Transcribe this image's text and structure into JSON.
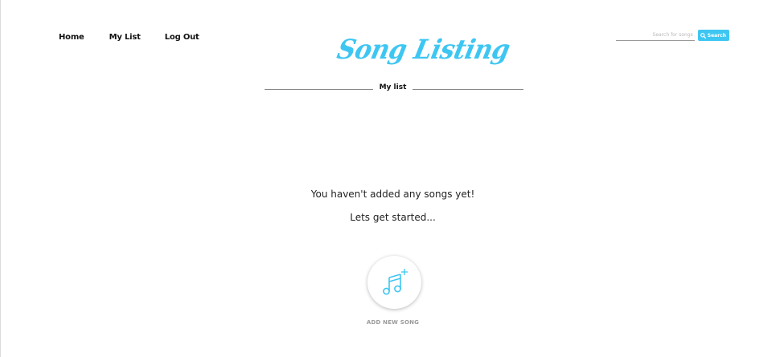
{
  "nav": {
    "home": "Home",
    "my_list": "My List",
    "log_out": "Log Out"
  },
  "logo": {
    "text": "Song Listing"
  },
  "section": {
    "title": "My list"
  },
  "search": {
    "placeholder": "Search for songs",
    "value": "",
    "button_label": "Search",
    "button_icon": "search-icon"
  },
  "empty_state": {
    "title": "You haven't added any songs yet!",
    "subtitle": "Lets get started..."
  },
  "add_song": {
    "label": "ADD NEW SONG",
    "icon": "music-note-add-icon"
  },
  "colors": {
    "accent": "#3ec6f2",
    "text": "#111111",
    "muted": "#9a9a9a"
  }
}
